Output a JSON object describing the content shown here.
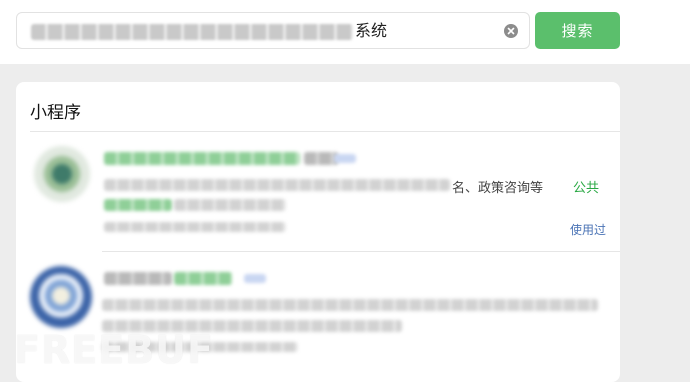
{
  "search": {
    "query_visible_suffix": "系统",
    "button_label": "搜索"
  },
  "section": {
    "title": "小程序"
  },
  "results": [
    {
      "desc_visible": "名、政策咨询等",
      "desc_visible_green": "公共",
      "used_label": "使用过"
    },
    {}
  ],
  "watermark": "FREEBUF",
  "colors": {
    "accent_green": "#5bbf6c",
    "highlight_green": "#2aa844",
    "link_blue": "#4a73b5"
  },
  "icons": [
    "clear-icon"
  ]
}
